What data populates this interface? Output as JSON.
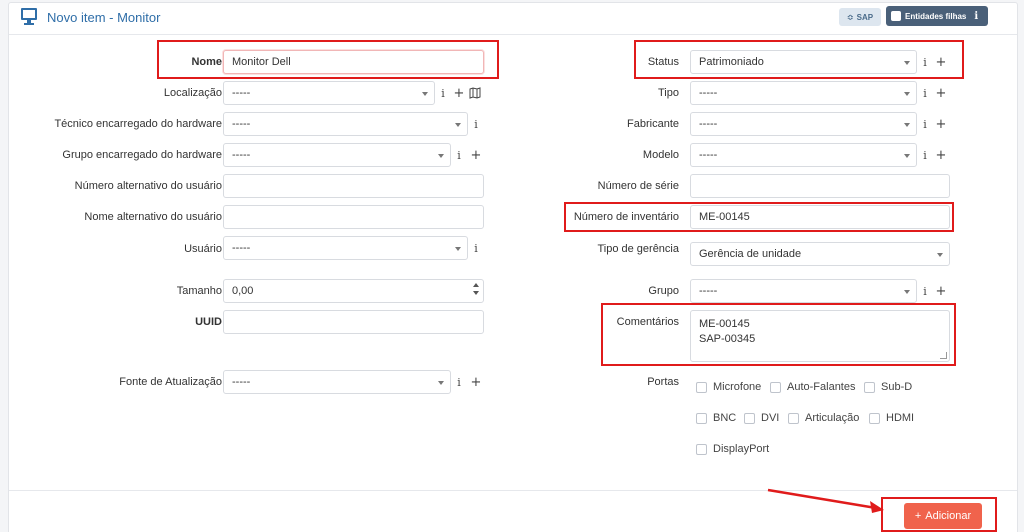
{
  "header": {
    "title": "Novo item - Monitor",
    "sap_label": "SAP",
    "entities_label": "Entidades filhas",
    "entities_info": "i"
  },
  "left": {
    "nome": {
      "label": "Nome",
      "value": "Monitor Dell"
    },
    "localizacao": {
      "label": "Localização",
      "value": "-----"
    },
    "tecnico": {
      "label": "Técnico encarregado do hardware",
      "value": "-----"
    },
    "grupo_hw": {
      "label": "Grupo encarregado do hardware",
      "value": "-----"
    },
    "num_alt": {
      "label": "Número alternativo do usuário",
      "value": ""
    },
    "nome_alt": {
      "label": "Nome alternativo do usuário",
      "value": ""
    },
    "usuario": {
      "label": "Usuário",
      "value": "-----"
    },
    "tamanho": {
      "label": "Tamanho",
      "value": "0,00"
    },
    "uuid": {
      "label": "UUID",
      "value": ""
    },
    "fonte": {
      "label": "Fonte de Atualização",
      "value": "-----"
    }
  },
  "right": {
    "status": {
      "label": "Status",
      "value": "Patrimoniado"
    },
    "tipo": {
      "label": "Tipo",
      "value": "-----"
    },
    "fabricante": {
      "label": "Fabricante",
      "value": "-----"
    },
    "modelo": {
      "label": "Modelo",
      "value": "-----"
    },
    "serie": {
      "label": "Número de série",
      "value": ""
    },
    "inventario": {
      "label": "Número de inventário",
      "value": "ME-00145"
    },
    "gerencia": {
      "label": "Tipo de gerência",
      "value": "Gerência de unidade"
    },
    "grupo": {
      "label": "Grupo",
      "value": "-----"
    },
    "comentarios": {
      "label": "Comentários",
      "line1": "ME-00145",
      "line2": "SAP-00345"
    },
    "portas": {
      "label": "Portas",
      "items": [
        "Microfone",
        "Auto-Falantes",
        "Sub-D",
        "BNC",
        "DVI",
        "Articulação",
        "HDMI",
        "DisplayPort"
      ]
    }
  },
  "icons": {
    "info": "i",
    "plus": "+"
  },
  "footer": {
    "add_label": "Adicionar",
    "add_icon": "+"
  },
  "colors": {
    "accent": "#2f6ea8",
    "add": "#f0634c",
    "highlight": "#e01b1b"
  }
}
